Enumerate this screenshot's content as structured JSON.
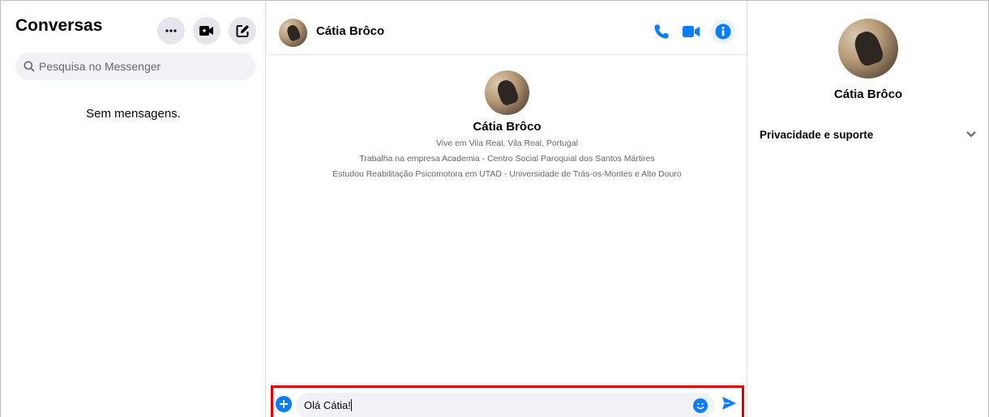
{
  "colors": {
    "accent": "#0a7cff",
    "search_bg": "#f0f2f5",
    "btn_bg": "#e4e6eb",
    "highlight_border": "#e00000"
  },
  "sidebar": {
    "title": "Conversas",
    "buttons": [
      {
        "name": "more-options",
        "icon": "ellipsis-icon"
      },
      {
        "name": "new-video-call",
        "icon": "video-plus-icon"
      },
      {
        "name": "new-message",
        "icon": "compose-icon"
      }
    ],
    "search_placeholder": "Pesquisa no Messenger",
    "empty_text": "Sem mensagens."
  },
  "chat": {
    "contact_name": "Cátia Brôco",
    "header_icons": [
      "phone-icon",
      "video-camera-icon",
      "info-icon"
    ],
    "profile": {
      "name": "Cátia Brôco",
      "lines": [
        "Vive em Vila Real, Vila Real, Portugal",
        "Trabalha na empresa Academia - Centro Social Paroquial dos Santos Mártires",
        "Estudou Reabilitação Psicomotora em UTAD - Universidade de Trás-os-Montes e Alto Douro"
      ]
    },
    "composer": {
      "text": "Olá Cátia!"
    }
  },
  "info_panel": {
    "name": "Cátia Brôco",
    "section_label": "Privacidade e suporte"
  }
}
